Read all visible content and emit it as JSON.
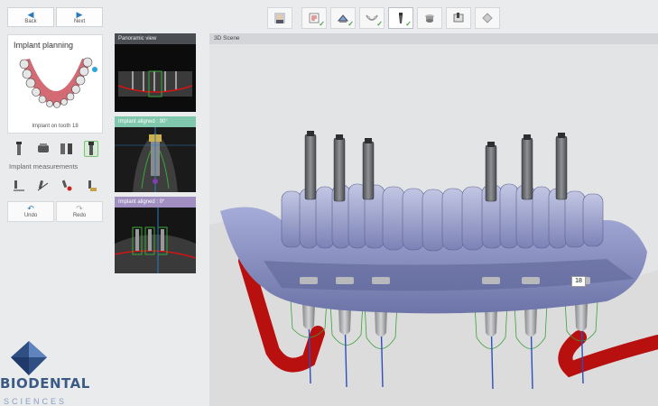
{
  "nav": {
    "back_label": "Back",
    "next_label": "Next"
  },
  "workflow": {
    "steps": [
      {
        "icon": "patient-photo-icon",
        "done": false
      },
      {
        "icon": "prescription-icon",
        "done": true
      },
      {
        "icon": "scan-import-icon",
        "done": true
      },
      {
        "icon": "jaw-alignment-icon",
        "done": true
      },
      {
        "icon": "implant-planning-icon",
        "done": true,
        "active": true
      },
      {
        "icon": "abutment-icon",
        "done": false
      },
      {
        "icon": "guide-design-icon",
        "done": false
      },
      {
        "icon": "export-icon",
        "done": false
      }
    ]
  },
  "left_panel": {
    "title": "Implant planning",
    "subtitle": "Implant on tooth 18",
    "measurements_label": "Implant measurements",
    "undo_label": "Undo",
    "redo_label": "Redo"
  },
  "views": {
    "panoramic": "Panoramic view",
    "aligned_90": "Implant aligned : 90°",
    "aligned_0": "Implant aligned : 0°"
  },
  "scene": {
    "title": "3D Scene",
    "tooth_tag": "18"
  },
  "logo": {
    "text": "BIODENTAL",
    "sub": "SCIENCES"
  },
  "colors": {
    "accent_blue": "#2b7bb9",
    "aligned90_header": "#7fc7ad",
    "aligned0_header": "#a08fc0",
    "nerve_red": "#d21414",
    "model_blue": "#8e96c8"
  }
}
